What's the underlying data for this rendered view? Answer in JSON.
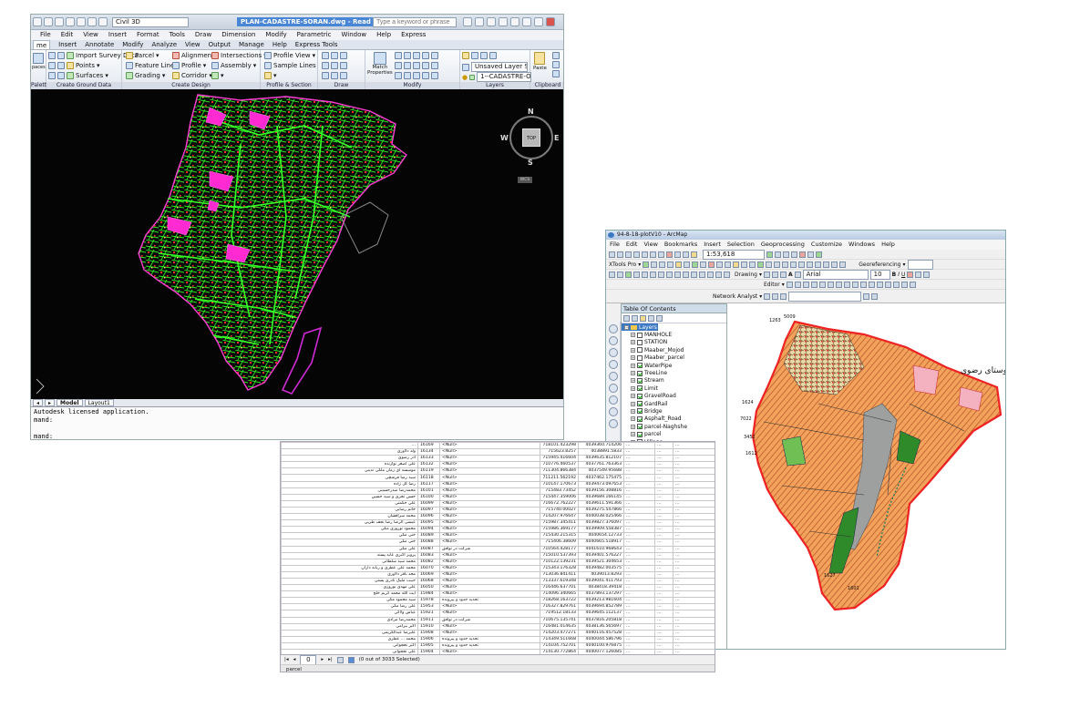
{
  "cad": {
    "workspace": "Civil 3D",
    "title": "PLAN-CADASTRE-SORAN.dwg - Read Only",
    "search_placeholder": "Type a keyword or phrase",
    "menu": [
      "File",
      "Edit",
      "View",
      "Insert",
      "Format",
      "Tools",
      "Draw",
      "Dimension",
      "Modify",
      "Parametric",
      "Window",
      "Help",
      "Express"
    ],
    "ribbon_tabs": [
      "me",
      "Insert",
      "Annotate",
      "Modify",
      "Analyze",
      "View",
      "Output",
      "Manage",
      "Help",
      "Express Tools"
    ],
    "ribbon": {
      "palettes_btn": "paces",
      "import_survey": "Import Survey Data",
      "points": "Points",
      "surfaces": "Surfaces",
      "parcel": "Parcel",
      "feature_line": "Feature Line",
      "grading": "Grading",
      "alignment": "Alignment",
      "profile": "Profile",
      "corridor": "Corridor",
      "intersections": "Intersections",
      "assembly": "Assembly",
      "profile_view": "Profile View",
      "sample_lines": "Sample Lines",
      "match_properties_1": "Match",
      "match_properties_2": "Properties",
      "layer_state": "Unsaved Layer State",
      "layer_current": "1--CADASTRE-OK",
      "paste": "Paste",
      "groups": [
        "Palettes",
        "Create Ground Data",
        "Create Design",
        "Profile & Section Views",
        "Draw",
        "Modify",
        "Layers",
        "Clipboard"
      ]
    },
    "viewcube": {
      "n": "N",
      "s": "S",
      "e": "E",
      "w": "W",
      "top": "TOP",
      "wcs": "WCS"
    },
    "tabs": [
      "Model",
      "Layout1"
    ],
    "command_lines": [
      "Autodesk licensed application.",
      "mand:",
      "",
      "mand:"
    ]
  },
  "arc": {
    "title": "94-8-18-plotV10 - ArcMap",
    "menu": [
      "File",
      "Edit",
      "View",
      "Bookmarks",
      "Insert",
      "Selection",
      "Geoprocessing",
      "Customize",
      "Windows",
      "Help"
    ],
    "scale": "1:53,618",
    "xtools": "XTools Pro",
    "georef": "Georeferencing",
    "drawing": "Drawing",
    "font": "Arial",
    "font_size": "10",
    "editor": "Editor",
    "network": "Network Analyst",
    "toc_title": "Table Of Contents",
    "layers_root": "Layers",
    "layers": [
      {
        "name": "MANHOLE",
        "on": false
      },
      {
        "name": "STATION",
        "on": false
      },
      {
        "name": "Maaber_Mojod",
        "on": false
      },
      {
        "name": "Maaber_parcel",
        "on": false
      },
      {
        "name": "WaterPipe",
        "on": true
      },
      {
        "name": "TreeLine",
        "on": true
      },
      {
        "name": "Stream",
        "on": true
      },
      {
        "name": "Limit",
        "on": true
      },
      {
        "name": "GravelRoad",
        "on": true
      },
      {
        "name": "GardRail",
        "on": true
      },
      {
        "name": "Bridge",
        "on": true
      },
      {
        "name": "Asphalt_Road",
        "on": true
      },
      {
        "name": "parcel-Naghshe",
        "on": true
      },
      {
        "name": "parcel",
        "on": true
      },
      {
        "name": "Village",
        "on": true
      }
    ],
    "map_label": "روستای رضوی",
    "map_numbers": [
      "1263",
      "5009",
      "1624",
      "7022",
      "3452",
      "1612",
      "1627",
      "1601"
    ]
  },
  "table": {
    "rows": [
      [
        "…",
        "16169",
        "<Null>",
        "718101.423298",
        "4039360.714206",
        "…",
        "…",
        "…"
      ],
      [
        "ولد دلاوری",
        "16134",
        "<Null>",
        "715623.8257",
        "4038891.5833",
        "…",
        "…",
        "…"
      ],
      [
        "آذر رضوی",
        "16133",
        "<Null>",
        "715945.416604",
        "4039635.812107",
        "…",
        "…",
        "…"
      ],
      [
        "علی اصغر نوازنده",
        "16132",
        "<Null>",
        "710776.460537",
        "4037761.763363",
        "…",
        "…",
        "…"
      ],
      [
        "موسسه ای زمان ملکی تدینی",
        "16119",
        "<Null>",
        "711304.866384",
        "4037549.95688",
        "…",
        "…",
        "…"
      ],
      [
        "سید رضا فرشچی",
        "16118",
        "<Null>",
        "711211.562192",
        "4037462.175475",
        "…",
        "…",
        "…"
      ],
      [
        "رضا گل زاده",
        "16117",
        "<Null>",
        "710147.170673",
        "4039473.097653",
        "…",
        "…",
        "…"
      ],
      [
        "محمدرضا صدرحسینی",
        "16101",
        "<Null>",
        "715483.73452",
        "4039156.308816",
        "…",
        "…",
        "…"
      ],
      [
        "حسن تجری و سید حسین",
        "16100",
        "<Null>",
        "715447.359006",
        "4039689.166145",
        "…",
        "…",
        "…"
      ],
      [
        "علی حکمتی",
        "16099",
        "<Null>",
        "716672.762227",
        "4039611.591366",
        "…",
        "…",
        "…"
      ],
      [
        "خانم رضایی",
        "16097",
        "<Null>",
        "715740.00027",
        "4039275.547866",
        "…",
        "…",
        "…"
      ],
      [
        "محمد سراقشان",
        "16096",
        "<Null>",
        "714207.976647",
        "4040038.025466",
        "…",
        "…",
        "…"
      ],
      [
        "عیسی الرضا رضا نجف طربی",
        "16095",
        "<Null>",
        "715987.345411",
        "4039827.376097",
        "…",
        "…",
        "…"
      ],
      [
        "محمود نوروزی مکی",
        "16094",
        "<Null>",
        "715986.369177",
        "4039909.558387",
        "…",
        "…",
        "…"
      ],
      [
        "خنی مکی",
        "16089",
        "<Null>",
        "715430.215315",
        "4040654.12733",
        "…",
        "…",
        "…"
      ],
      [
        "خنی مکی",
        "16088",
        "<Null>",
        "715406.38609",
        "4040665.518917",
        "…",
        "…",
        "…"
      ],
      [
        "علی مکی",
        "16087",
        "شرکت در توافق",
        "710564.428177",
        "4041610.968643",
        "…",
        "…",
        "…"
      ],
      [
        "پرویز اکبری عابد پسند",
        "16083",
        "<Null>",
        "715010.537393",
        "4039401.576227",
        "…",
        "…",
        "…"
      ],
      [
        "محمد سید سلطانی",
        "16082",
        "<Null>",
        "710122.139231",
        "4039521.304653",
        "…",
        "…",
        "…"
      ],
      [
        "محمد علی عطری و ربابه داران",
        "16070",
        "<Null>",
        "715343.176328",
        "4039482.003575",
        "…",
        "…",
        "…"
      ],
      [
        "مجد باقر دلاوری",
        "16069",
        "<Null>",
        "713036.841411",
        "4039013.8293",
        "…",
        "…",
        "…"
      ],
      [
        "حبیب ملیک نادری پستی",
        "16068",
        "<Null>",
        "713337.619348",
        "4039041.411793",
        "…",
        "…",
        "…"
      ],
      [
        "علی مهدی نوروزی",
        "16050",
        "<Null>",
        "716446.637701",
        "4038418.39418",
        "…",
        "…",
        "…"
      ],
      [
        "آیت الله محمد کریم خلج",
        "15984",
        "<Null>",
        "714096.340665",
        "4037893.137297",
        "…",
        "…",
        "…"
      ],
      [
        "سید محمود مکی",
        "15978",
        "تحدید حدود و پیرونده",
        "718268.163722",
        "4039213.981604",
        "…",
        "…",
        "…"
      ],
      [
        "علی رضا مکی",
        "15953",
        "<Null>",
        "716327.829761",
        "4039694.852789",
        "…",
        "…",
        "…"
      ],
      [
        "عباس ولاکی",
        "15921",
        "<Null>",
        "719512.18133",
        "4039645.112137",
        "…",
        "…",
        "…"
      ],
      [
        "محمدرضا مرادی",
        "15911",
        "شرکت در توافق",
        "710675.135741",
        "4037816.205818",
        "…",
        "…",
        "…"
      ],
      [
        "اکبر بیرامی",
        "15910",
        "<Null>",
        "716481.014635",
        "4038136.565697",
        "…",
        "…",
        "…"
      ],
      [
        "علیرضا عبدالکریمی",
        "15908",
        "<Null>",
        "714203.477271",
        "4040116.457528",
        "…",
        "…",
        "…"
      ],
      [
        "محمد ... عطری",
        "15906",
        "تحدید حدود و پیرونده",
        "714349.511668",
        "4040044.586796",
        "…",
        "…",
        "…"
      ],
      [
        "اکبر نخجوانی",
        "15905",
        "تحدید حدود و پیرونده",
        "714104.752701",
        "4040100.976875",
        "…",
        "…",
        "…"
      ],
      [
        "علی نخجوانی",
        "15904",
        "<Null>",
        "714130.772864",
        "4040077.126085",
        "…",
        "…",
        "…"
      ],
      [
        "قربانعلی نخجوانی",
        "15904",
        "<Null>",
        "714074.199362",
        "4040029.220717",
        "…",
        "…",
        "…"
      ],
      [
        "نرجس علی نجمی",
        "15803",
        "<Null>",
        "714387.108026",
        "4040071.230292",
        "…",
        "…",
        "…"
      ]
    ],
    "nav_count": "0",
    "selection_status": "(0 out of 3033 Selected)",
    "tab_name": "parcel"
  }
}
